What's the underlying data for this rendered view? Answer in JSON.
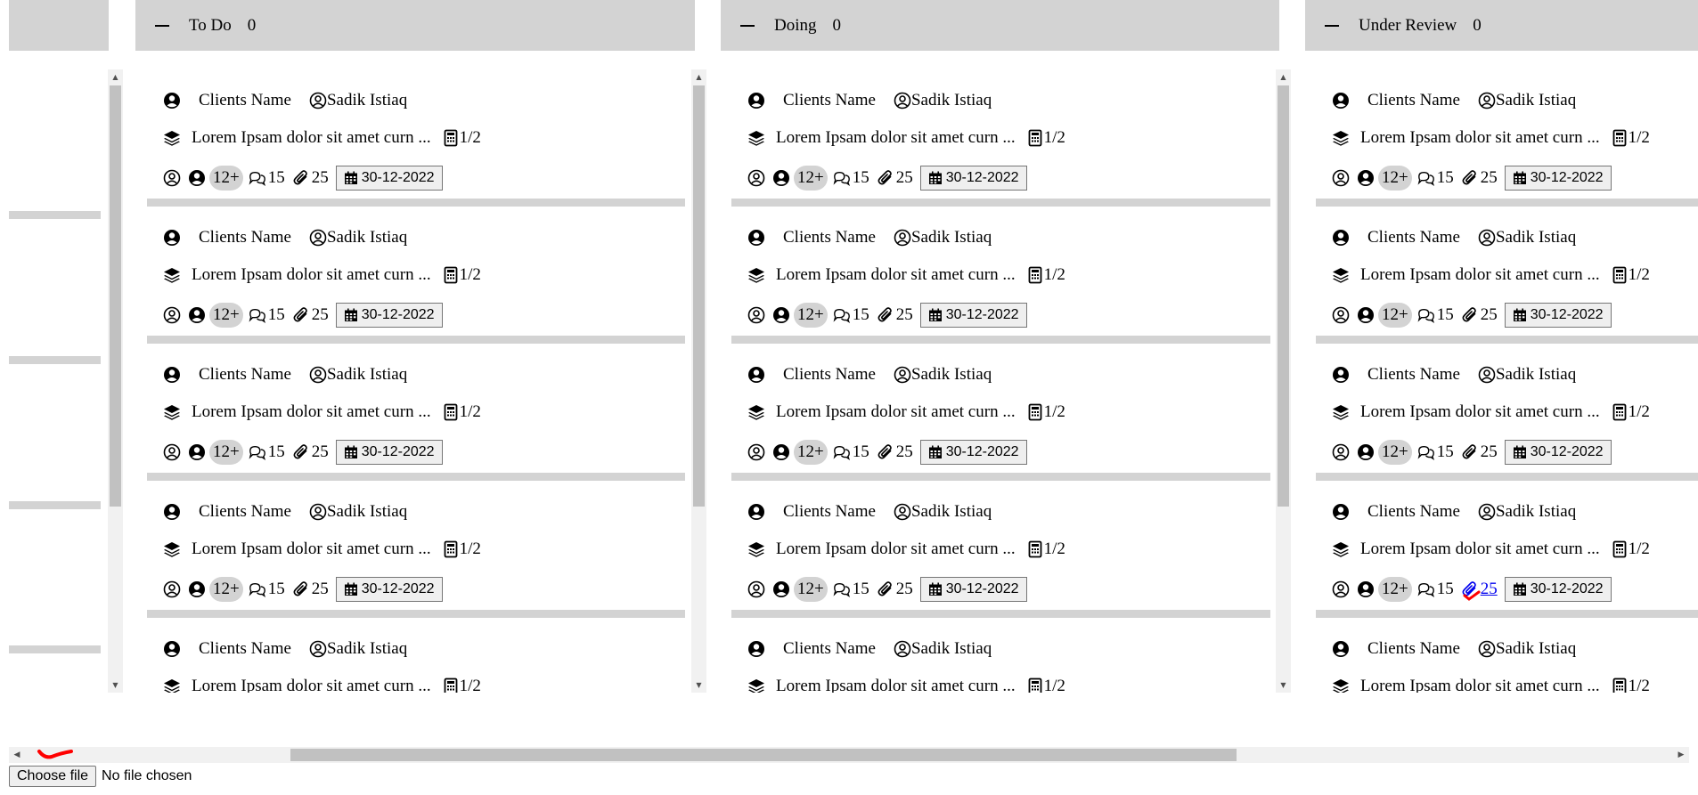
{
  "board": {
    "columns": [
      {
        "title": "To Do",
        "count": "0"
      },
      {
        "title": "Doing",
        "count": "0"
      },
      {
        "title": "Under Review",
        "count": "0"
      }
    ],
    "card": {
      "client_label": "Clients Name",
      "assignee": "Sadik Istiaq",
      "description": "Lorem Ipsam dolor sit amet curn ...",
      "subtasks": "1/2",
      "members_badge": "12+",
      "comments": "15",
      "attachments": "25",
      "due_date": "30-12-2022"
    }
  },
  "file_input": {
    "button_label": "Choose file",
    "status": "No file chosen"
  },
  "icons": [
    "user-circle-icon",
    "user-outline-icon",
    "layers-icon",
    "calculator-icon",
    "comments-icon",
    "paperclip-icon",
    "calendar-icon",
    "minus-icon"
  ],
  "colors": {
    "header_bg": "#d3d3d3",
    "scrollbar_thumb": "#c1c1c1",
    "link": "#0000ee",
    "annotation": "#ff0000"
  }
}
